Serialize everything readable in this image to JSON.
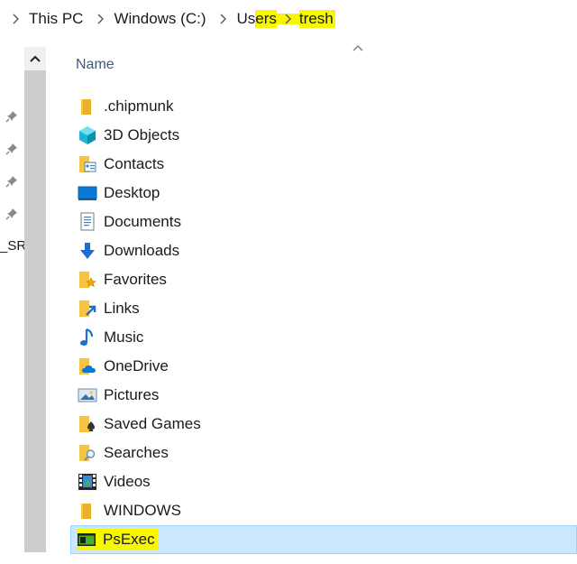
{
  "breadcrumb": {
    "items": [
      "This PC",
      "Windows (C:)"
    ],
    "users_plain": "Us",
    "users_highlight": "ers",
    "current": "tresh"
  },
  "nav": {
    "truncated_label": "_SRS"
  },
  "columns": {
    "name": "Name"
  },
  "colors": {
    "highlight": "#f7f700",
    "selection_bg": "#cce8ff",
    "selection_border": "#99d1ff",
    "folder": "#f4c542",
    "accent_blue": "#0078d7"
  },
  "files": [
    {
      "name": ".chipmunk",
      "icon": "folder-icon"
    },
    {
      "name": "3D Objects",
      "icon": "3d-objects-icon"
    },
    {
      "name": "Contacts",
      "icon": "contacts-folder-icon"
    },
    {
      "name": "Desktop",
      "icon": "desktop-icon"
    },
    {
      "name": "Documents",
      "icon": "documents-icon"
    },
    {
      "name": "Downloads",
      "icon": "downloads-icon"
    },
    {
      "name": "Favorites",
      "icon": "favorites-folder-icon"
    },
    {
      "name": "Links",
      "icon": "links-folder-icon"
    },
    {
      "name": "Music",
      "icon": "music-icon"
    },
    {
      "name": "OneDrive",
      "icon": "onedrive-icon"
    },
    {
      "name": "Pictures",
      "icon": "pictures-icon"
    },
    {
      "name": "Saved Games",
      "icon": "saved-games-icon"
    },
    {
      "name": "Searches",
      "icon": "searches-folder-icon"
    },
    {
      "name": "Videos",
      "icon": "videos-icon"
    },
    {
      "name": "WINDOWS",
      "icon": "folder-icon"
    },
    {
      "name": "PsExec",
      "icon": "executable-icon",
      "selected": true
    }
  ]
}
